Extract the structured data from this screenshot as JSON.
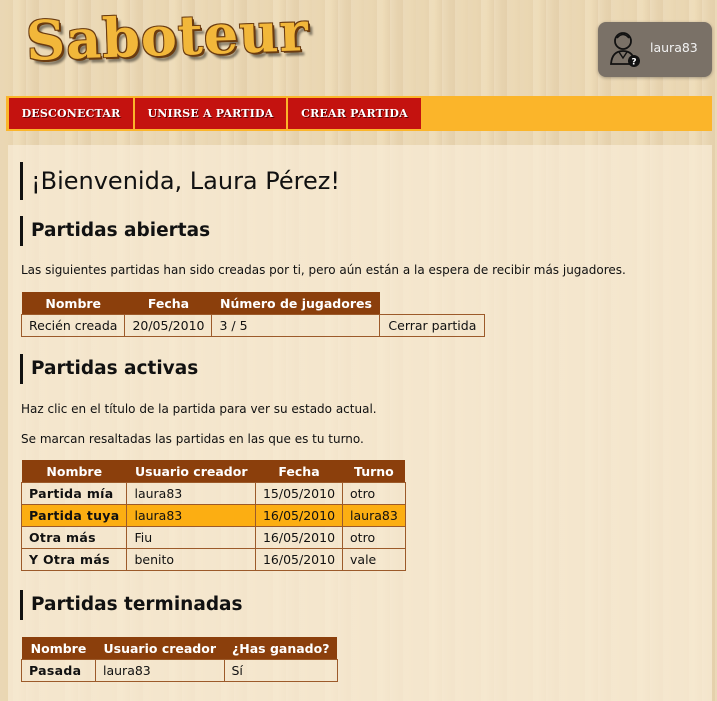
{
  "logo": "Saboteur",
  "user": {
    "name": "laura83",
    "avatar_icon": "user-avatar-icon"
  },
  "nav": {
    "disconnect": "DESCONECTAR",
    "join": "UNIRSE A PARTIDA",
    "create": "CREAR PARTIDA"
  },
  "welcome": "¡Bienvenida, Laura Pérez!",
  "open": {
    "title": "Partidas abiertas",
    "description": "Las siguientes partidas han sido creadas por ti, pero aún están a la espera de recibir más jugadores.",
    "headers": [
      "Nombre",
      "Fecha",
      "Número de jugadores"
    ],
    "rows": [
      {
        "name": "Recién creada",
        "date": "20/05/2010",
        "players": "3 / 5",
        "action": "Cerrar partida"
      }
    ]
  },
  "active": {
    "title": "Partidas activas",
    "description1": "Haz clic en el título de la partida para ver su estado actual.",
    "description2": "Se marcan resaltadas las partidas en las que es tu turno.",
    "headers": [
      "Nombre",
      "Usuario creador",
      "Fecha",
      "Turno"
    ],
    "rows": [
      {
        "name": "Partida mía",
        "creator": "laura83",
        "date": "15/05/2010",
        "turn": "otro"
      },
      {
        "name": "Partida tuya",
        "creator": "laura83",
        "date": "16/05/2010",
        "turn": "laura83",
        "highlight": true
      },
      {
        "name": "Otra más",
        "creator": "Fiu",
        "date": "16/05/2010",
        "turn": "otro"
      },
      {
        "name": "Y Otra más",
        "creator": "benito",
        "date": "16/05/2010",
        "turn": "vale"
      }
    ]
  },
  "finished": {
    "title": "Partidas terminadas",
    "headers": [
      "Nombre",
      "Usuario creador",
      "¿Has ganado?"
    ],
    "rows": [
      {
        "name": "Pasada",
        "creator": "laura83",
        "won": "Sí"
      }
    ]
  },
  "colors": {
    "nav_bar": "#fbb52a",
    "nav_button": "#c4120f",
    "table_header": "#8b3f0c",
    "highlight_row": "#fcae12",
    "user_box": "#7a7167"
  }
}
